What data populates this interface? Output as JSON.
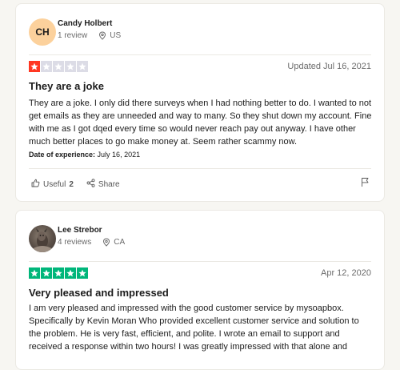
{
  "colors": {
    "star_red": "#ff3722",
    "star_green": "#00b67a",
    "star_empty": "#dcdce6",
    "avatar_bg": "#fcd19c"
  },
  "reviews": [
    {
      "initials": "CH",
      "name": "Candy Holbert",
      "review_count": "1 review",
      "country": "US",
      "rating": 1,
      "date": "Updated Jul 16, 2021",
      "title": "They are a joke",
      "body": "They are a joke. I only did there surveys when I had nothing better to do. I wanted to not get emails as they are unneeded and way to many. So they shut down my account. Fine with me as I got dqed every time so would never reach pay out anyway. I have other much better places to go make money at. Seem rather scammy now.",
      "experience_label": "Date of experience:",
      "experience_date": "July 16, 2021",
      "useful_label": "Useful",
      "useful_count": "2",
      "share_label": "Share"
    },
    {
      "name": "Lee Strebor",
      "review_count": "4 reviews",
      "country": "CA",
      "rating": 5,
      "date": "Apr 12, 2020",
      "title": "Very pleased and impressed",
      "body": "I am very pleased and impressed with the good customer service by mysoapbox. Specifically by Kevin Moran Who provided excellent customer service and solution to the problem. He is very fast, efficient, and polite. I wrote an email to support and received a response within two hours! I was greatly impressed with that alone and"
    }
  ]
}
